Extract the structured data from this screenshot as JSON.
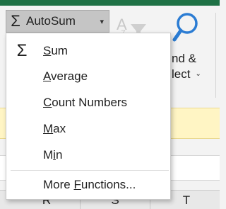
{
  "ribbon": {
    "autosum_button": {
      "icon": "sigma-icon",
      "label": "AutoSum",
      "caret_icon": "chevron-down-icon"
    },
    "sort_filter_icon": "sort-filter-icon",
    "find_select": {
      "icon": "magnifier-icon",
      "line1": "nd &",
      "line2": "lect",
      "caret_icon": "chevron-down-icon"
    }
  },
  "dropdown": {
    "items": [
      {
        "icon": "sigma-icon",
        "label": "Sum",
        "accel": "S"
      },
      {
        "label": "Average",
        "accel": "A"
      },
      {
        "label": "Count Numbers",
        "accel": "C"
      },
      {
        "label": "Max",
        "accel": "M"
      },
      {
        "label": "Min",
        "accel": "i"
      }
    ],
    "more": {
      "label": "More Functions...",
      "accel": "F"
    }
  },
  "sheet": {
    "column_headers": [
      "R",
      "S",
      "T"
    ]
  },
  "colors": {
    "excel_green": "#1e7145",
    "button_pressed": "#c5c5c5",
    "message_bar": "#fff5c4",
    "find_icon_blue": "#2b7cd3"
  }
}
